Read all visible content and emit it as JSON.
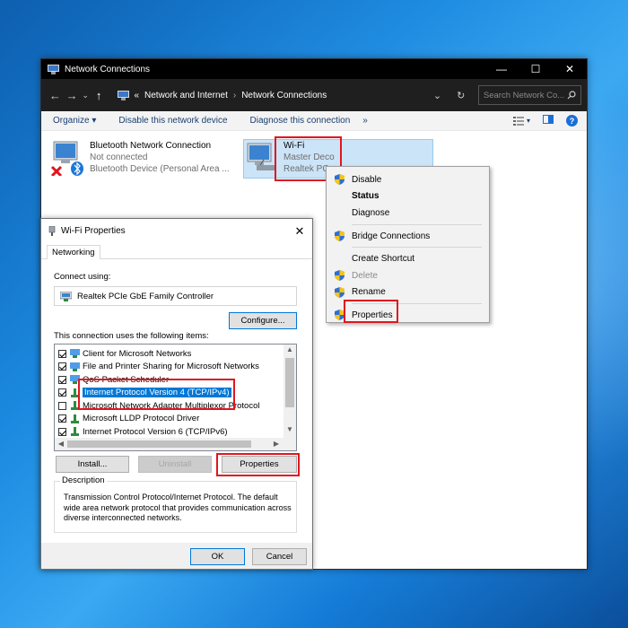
{
  "window": {
    "title": "Network Connections",
    "minimize": "—",
    "maximize": "☐",
    "close": "✕"
  },
  "address": {
    "back": "←",
    "forward": "→",
    "dropdown": "⌄",
    "up": "↑",
    "chevrons": "«",
    "crumb1": "Network and Internet",
    "separator": "›",
    "crumb2": "Network Connections",
    "history": "⌄",
    "refresh": "↻",
    "search_placeholder": "Search Network Co..."
  },
  "command_bar": {
    "organize": "Organize ▾",
    "disable": "Disable this network device",
    "diagnose": "Diagnose this connection",
    "more": "»",
    "view_options": "▾",
    "help": "?"
  },
  "adapters": [
    {
      "name": "Bluetooth Network Connection",
      "status": "Not connected",
      "device": "Bluetooth Device (Personal Area ..."
    },
    {
      "name": "Wi-Fi",
      "status": "Master Deco",
      "device": "Realtek PC"
    }
  ],
  "context_menu": {
    "items": [
      "Disable",
      "Status",
      "Diagnose",
      "Bridge Connections",
      "Create Shortcut",
      "Delete",
      "Rename",
      "Properties"
    ]
  },
  "dialog": {
    "title": "Wi-Fi Properties",
    "close": "✕",
    "tab": "Networking",
    "connect_using_label": "Connect using:",
    "adapter_name": "Realtek PCIe GbE Family Controller",
    "configure_button": "Configure...",
    "items_label": "This connection uses the following items:",
    "items": [
      {
        "label": "Client for Microsoft Networks",
        "checked": true
      },
      {
        "label": "File and Printer Sharing for Microsoft Networks",
        "checked": true
      },
      {
        "label": "QoS Packet Scheduler",
        "checked": true
      },
      {
        "label": "Internet Protocol Version 4 (TCP/IPv4)",
        "checked": true
      },
      {
        "label": "Microsoft Network Adapter Multiplexor Protocol",
        "checked": false
      },
      {
        "label": "Microsoft LLDP Protocol Driver",
        "checked": true
      },
      {
        "label": "Internet Protocol Version 6 (TCP/IPv6)",
        "checked": true
      }
    ],
    "install_button": "Install...",
    "uninstall_button": "Uninstall",
    "properties_button": "Properties",
    "description_label": "Description",
    "description_text": "Transmission Control Protocol/Internet Protocol. The default wide area network protocol that provides communication across diverse interconnected networks.",
    "ok_button": "OK",
    "cancel_button": "Cancel"
  },
  "colors": {
    "highlight": "#0078d7",
    "annotation_red": "#e0161f",
    "selection_bg": "#cce4f7"
  }
}
